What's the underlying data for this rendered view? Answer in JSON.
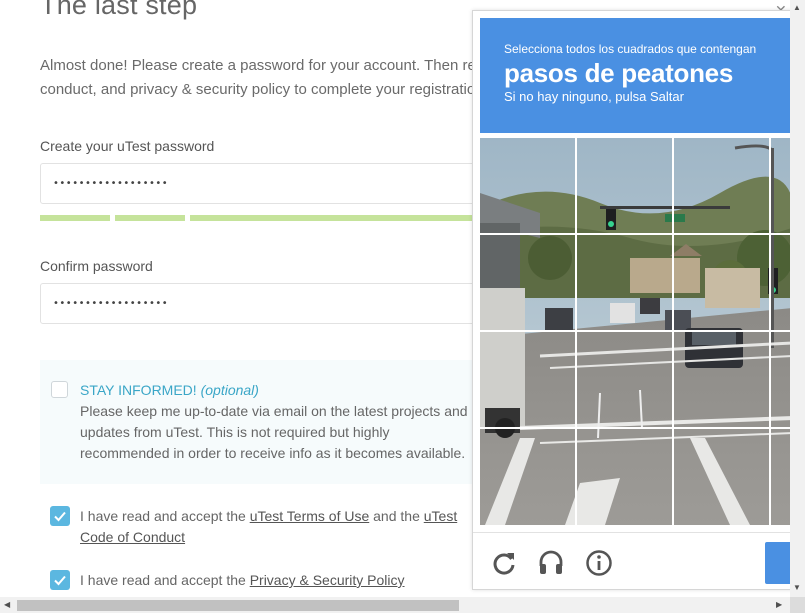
{
  "page": {
    "title": "The last step",
    "intro": "Almost done! Please create a password for your account. Then review and accept the terms of use, code of conduct, and privacy & security policy to complete your registration."
  },
  "password": {
    "label": "Create your uTest password",
    "value": "••••••••••••••••••",
    "strength_segments": 3
  },
  "confirm": {
    "label": "Confirm password",
    "value": "••••••••••••••••••"
  },
  "stay_informed": {
    "title": "STAY INFORMED!",
    "optional": "(optional)",
    "text": "Please keep me up-to-date via email on the latest projects and updates from uTest. This is not required but highly recommended in order to receive info as it becomes available.",
    "checked": false
  },
  "terms": {
    "prefix": "I have read and accept the ",
    "link1": "uTest Terms of Use",
    "middle": " and the ",
    "link2": "uTest Code of Conduct",
    "checked": true
  },
  "privacy": {
    "prefix": "I have read and accept the ",
    "link": "Privacy & Security Policy",
    "checked": true
  },
  "captcha": {
    "instruction": "Selecciona todos los cuadrados que contengan",
    "target": "pasos de peatones",
    "subtitle": "Si no hay ninguno, pulsa Saltar",
    "rows": 4,
    "cols": 4,
    "icons": [
      "reload-icon",
      "audio-icon",
      "info-icon"
    ],
    "accent": "#4a90e2"
  },
  "colors": {
    "accent": "#5bb7e0",
    "strength": "#c5e39b",
    "captcha_header": "#4a90e2"
  }
}
